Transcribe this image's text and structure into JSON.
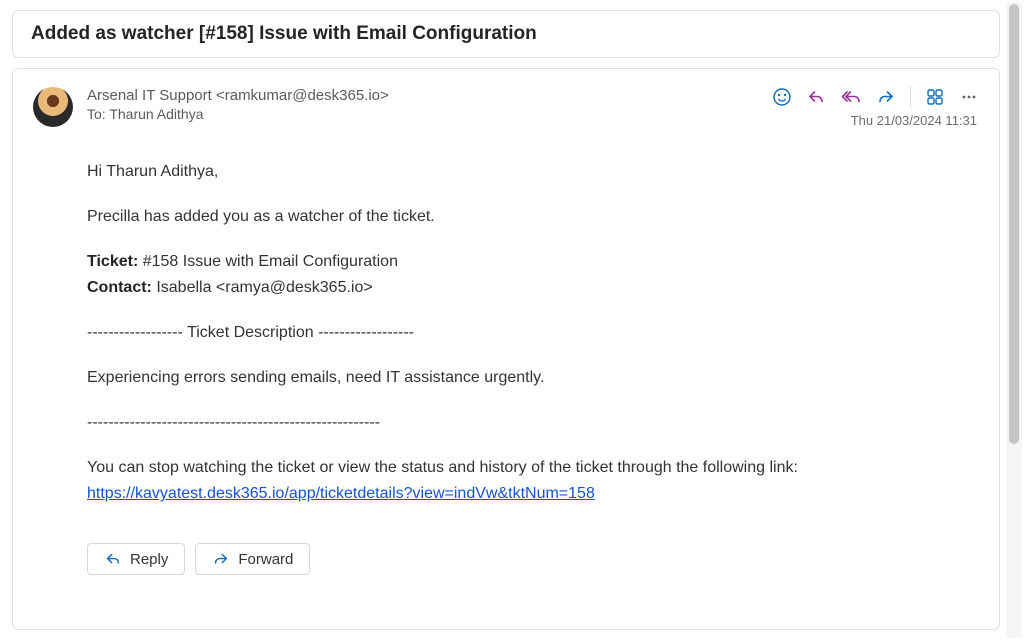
{
  "subject": "Added as watcher [#158] Issue with Email Configuration",
  "sender": {
    "name": "Arsenal IT Support",
    "email": "<ramkumar@desk365.io>"
  },
  "to_label": "To:",
  "recipient": "Tharun Adithya",
  "timestamp": "Thu 21/03/2024 11:31",
  "body": {
    "greeting": "Hi Tharun Adithya,",
    "intro": "Precilla has added you as a watcher of the ticket.",
    "ticket_label": "Ticket:",
    "ticket_value": " #158 Issue with Email Configuration",
    "contact_label": "Contact:",
    "contact_value": " Isabella <ramya@desk365.io>",
    "divider1": "------------------ Ticket Description ------------------",
    "description": " Experiencing errors sending emails, need IT assistance urgently.",
    "divider2": "-------------------------------------------------------",
    "footer_text": "You can stop watching the ticket or view the status and history of the ticket through the following link:",
    "link": "https://kavyatest.desk365.io/app/ticketdetails?view=indVw&tktNum=158"
  },
  "buttons": {
    "reply": "Reply",
    "forward": "Forward"
  },
  "colors": {
    "smile": "#0f6cbd",
    "reply": "#993399",
    "forward": "#0f6cbd",
    "btn_icon": "#0f6cbd"
  }
}
